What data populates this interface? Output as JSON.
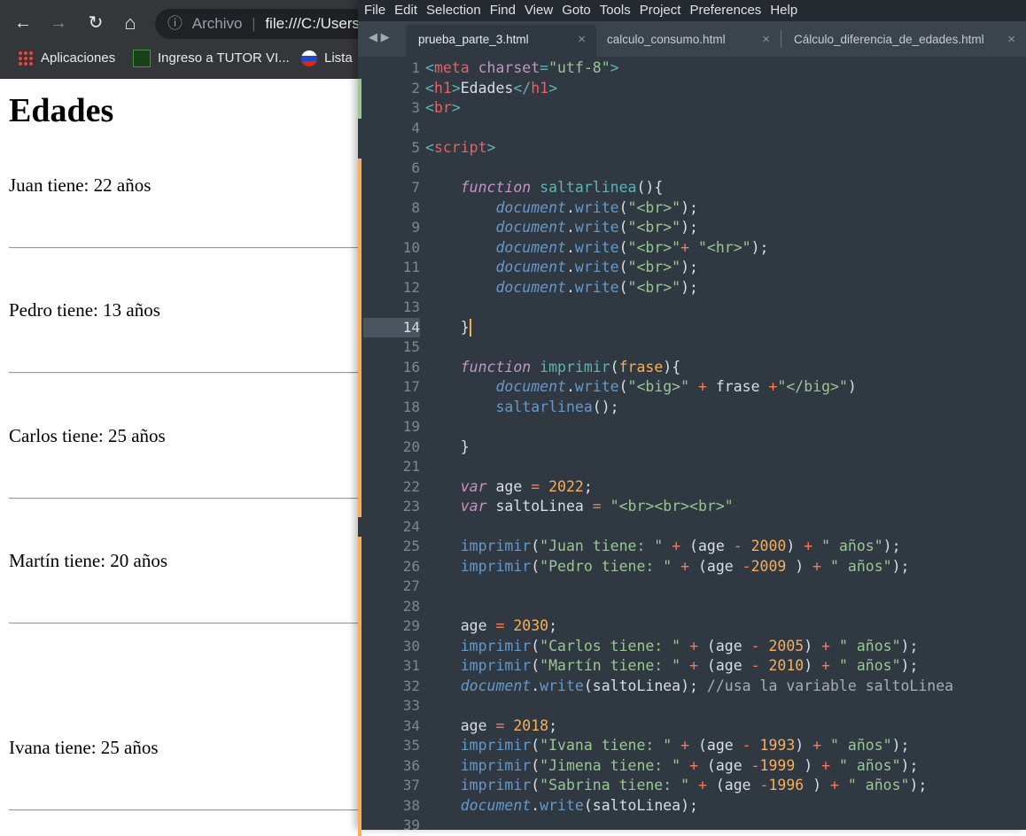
{
  "browser": {
    "nav": {
      "back": "←",
      "forward": "→",
      "reload": "↻",
      "home": "⌂"
    },
    "omnibox": {
      "info_icon": "ⓘ",
      "scheme_label": "Archivo",
      "url": "file:///C:/Users"
    },
    "bookmarks": [
      {
        "icon": "apps-grid-icon",
        "label": "Aplicaciones"
      },
      {
        "icon": "tutor-virtual-icon",
        "label": "Ingreso a TUTOR VI..."
      },
      {
        "icon": "flag-icon",
        "label": "Lista"
      }
    ],
    "page": {
      "heading": "Edades",
      "lines": [
        "Juan tiene: 22 años",
        "Pedro tiene: 13 años",
        "Carlos tiene: 25 años",
        "Martín tiene: 20 años",
        "Ivana tiene: 25 años"
      ]
    }
  },
  "editor": {
    "menu": [
      "File",
      "Edit",
      "Selection",
      "Find",
      "View",
      "Goto",
      "Tools",
      "Project",
      "Preferences",
      "Help"
    ],
    "tabs": [
      {
        "label": "prueba_parte_3.html",
        "active": true
      },
      {
        "label": "calculo_consumo.html",
        "active": false
      },
      {
        "label": "Cálculo_diferencia_de_edades.html",
        "active": false
      }
    ],
    "tab_close": "×",
    "current_line": 14,
    "colors": {
      "background": "#303841",
      "modified_marker": "#f9ae58",
      "added_marker": "#99c794"
    },
    "lines": [
      {
        "n": "1",
        "html": "<span class='tg'>&lt;</span><span class='tn'>meta</span> <span class='at'>charset</span><span class='tg'>=</span><span class='st'>\"utf-8\"</span><span class='tg'>&gt;</span>",
        "mark": ""
      },
      {
        "n": "2",
        "html": "<span class='tg'>&lt;</span><span class='tn'>h1</span><span class='tg'>&gt;</span>Edades<span class='tg'>&lt;/</span><span class='tn'>h1</span><span class='tg'>&gt;</span>",
        "mark": "add"
      },
      {
        "n": "3",
        "html": "<span class='tg'>&lt;</span><span class='tn'>br</span><span class='tg'>&gt;</span>",
        "mark": "add"
      },
      {
        "n": "4",
        "html": "",
        "mark": ""
      },
      {
        "n": "5",
        "html": "<span class='tg'>&lt;</span><span class='tn'>script</span><span class='tg'>&gt;</span>",
        "mark": ""
      },
      {
        "n": "6",
        "html": "",
        "mark": "mod"
      },
      {
        "n": "7",
        "html": "    <span class='kw'>function</span> <span class='fn'>saltarlinea</span>(){",
        "mark": "mod"
      },
      {
        "n": "8",
        "html": "        <span class='obj'>document</span>.<span class='me'>write</span>(<span class='st'>\"&lt;br&gt;\"</span>);",
        "mark": "mod"
      },
      {
        "n": "9",
        "html": "        <span class='obj'>document</span>.<span class='me'>write</span>(<span class='st'>\"&lt;br&gt;\"</span>);",
        "mark": "mod"
      },
      {
        "n": "10",
        "html": "        <span class='obj'>document</span>.<span class='me'>write</span>(<span class='st'>\"&lt;br&gt;\"</span><span class='op'>+</span> <span class='st'>\"&lt;hr&gt;\"</span>);",
        "mark": "mod"
      },
      {
        "n": "11",
        "html": "        <span class='obj'>document</span>.<span class='me'>write</span>(<span class='st'>\"&lt;br&gt;\"</span>);",
        "mark": "mod"
      },
      {
        "n": "12",
        "html": "        <span class='obj'>document</span>.<span class='me'>write</span>(<span class='st'>\"&lt;br&gt;\"</span>);",
        "mark": "mod"
      },
      {
        "n": "13",
        "html": "",
        "mark": "mod"
      },
      {
        "n": "14",
        "html": "    }<span class='caret'></span>",
        "mark": "mod"
      },
      {
        "n": "15",
        "html": "",
        "mark": "mod"
      },
      {
        "n": "16",
        "html": "    <span class='kw'>function</span> <span class='fn'>imprimir</span>(<span class='pa'>frase</span>){",
        "mark": "mod"
      },
      {
        "n": "17",
        "html": "        <span class='obj'>document</span>.<span class='me'>write</span>(<span class='st'>\"&lt;big&gt;\"</span> <span class='op'>+</span> frase <span class='op'>+</span><span class='st'>\"&lt;/big&gt;\"</span>)",
        "mark": "mod"
      },
      {
        "n": "18",
        "html": "        <span class='me'>saltarlinea</span>();",
        "mark": "mod"
      },
      {
        "n": "19",
        "html": "",
        "mark": "mod"
      },
      {
        "n": "20",
        "html": "    }",
        "mark": "mod"
      },
      {
        "n": "21",
        "html": "",
        "mark": "mod"
      },
      {
        "n": "22",
        "html": "    <span class='kw'>var</span> age <span class='op'>=</span> <span class='nu'>2022</span>;",
        "mark": "mod"
      },
      {
        "n": "23",
        "html": "    <span class='kw'>var</span> saltoLinea <span class='op'>=</span> <span class='st'>\"&lt;br&gt;&lt;br&gt;&lt;br&gt;\"</span>",
        "mark": "mod"
      },
      {
        "n": "24",
        "html": "",
        "mark": ""
      },
      {
        "n": "25",
        "html": "    <span class='me'>imprimir</span>(<span class='st'>\"Juan tiene: \"</span> <span class='op'>+</span> (age <span class='op'>-</span> <span class='nu'>2000</span>) <span class='op'>+</span> <span class='st'>\" años\"</span>);",
        "mark": "mod"
      },
      {
        "n": "26",
        "html": "    <span class='me'>imprimir</span>(<span class='st'>\"Pedro tiene: \"</span> <span class='op'>+</span> (age <span class='op'>-</span><span class='nu'>2009</span> ) <span class='op'>+</span> <span class='st'>\" años\"</span>);",
        "mark": "mod"
      },
      {
        "n": "27",
        "html": "",
        "mark": "mod"
      },
      {
        "n": "28",
        "html": "",
        "mark": "mod"
      },
      {
        "n": "29",
        "html": "    age <span class='op'>=</span> <span class='nu'>2030</span>;",
        "mark": "mod"
      },
      {
        "n": "30",
        "html": "    <span class='me'>imprimir</span>(<span class='st'>\"Carlos tiene: \"</span> <span class='op'>+</span> (age <span class='op'>-</span> <span class='nu'>2005</span>) <span class='op'>+</span> <span class='st'>\" años\"</span>);",
        "mark": "mod"
      },
      {
        "n": "31",
        "html": "    <span class='me'>imprimir</span>(<span class='st'>\"Martín tiene: \"</span> <span class='op'>+</span> (age <span class='op'>-</span> <span class='nu'>2010</span>) <span class='op'>+</span> <span class='st'>\" años\"</span>);",
        "mark": "mod"
      },
      {
        "n": "32",
        "html": "    <span class='obj'>document</span>.<span class='me'>write</span>(saltoLinea); <span class='cm'>//usa la variable saltoLinea</span>",
        "mark": "mod"
      },
      {
        "n": "33",
        "html": "",
        "mark": "mod"
      },
      {
        "n": "34",
        "html": "    age <span class='op'>=</span> <span class='nu'>2018</span>;",
        "mark": "mod"
      },
      {
        "n": "35",
        "html": "    <span class='me'>imprimir</span>(<span class='st'>\"Ivana tiene: \"</span> <span class='op'>+</span> (age <span class='op'>-</span> <span class='nu'>1993</span>) <span class='op'>+</span> <span class='st'>\" años\"</span>);",
        "mark": "mod"
      },
      {
        "n": "36",
        "html": "    <span class='me'>imprimir</span>(<span class='st'>\"Jimena tiene: \"</span> <span class='op'>+</span> (age <span class='op'>-</span><span class='nu'>1999</span> ) <span class='op'>+</span> <span class='st'>\" años\"</span>);",
        "mark": "mod"
      },
      {
        "n": "37",
        "html": "    <span class='me'>imprimir</span>(<span class='st'>\"Sabrina tiene: \"</span> <span class='op'>+</span> (age <span class='op'>-</span><span class='nu'>1996</span> ) <span class='op'>+</span> <span class='st'>\" años\"</span>);",
        "mark": "mod"
      },
      {
        "n": "38",
        "html": "    <span class='obj'>document</span>.<span class='me'>write</span>(saltoLinea);",
        "mark": "mod"
      },
      {
        "n": "39",
        "html": "",
        "mark": "mod"
      }
    ]
  }
}
